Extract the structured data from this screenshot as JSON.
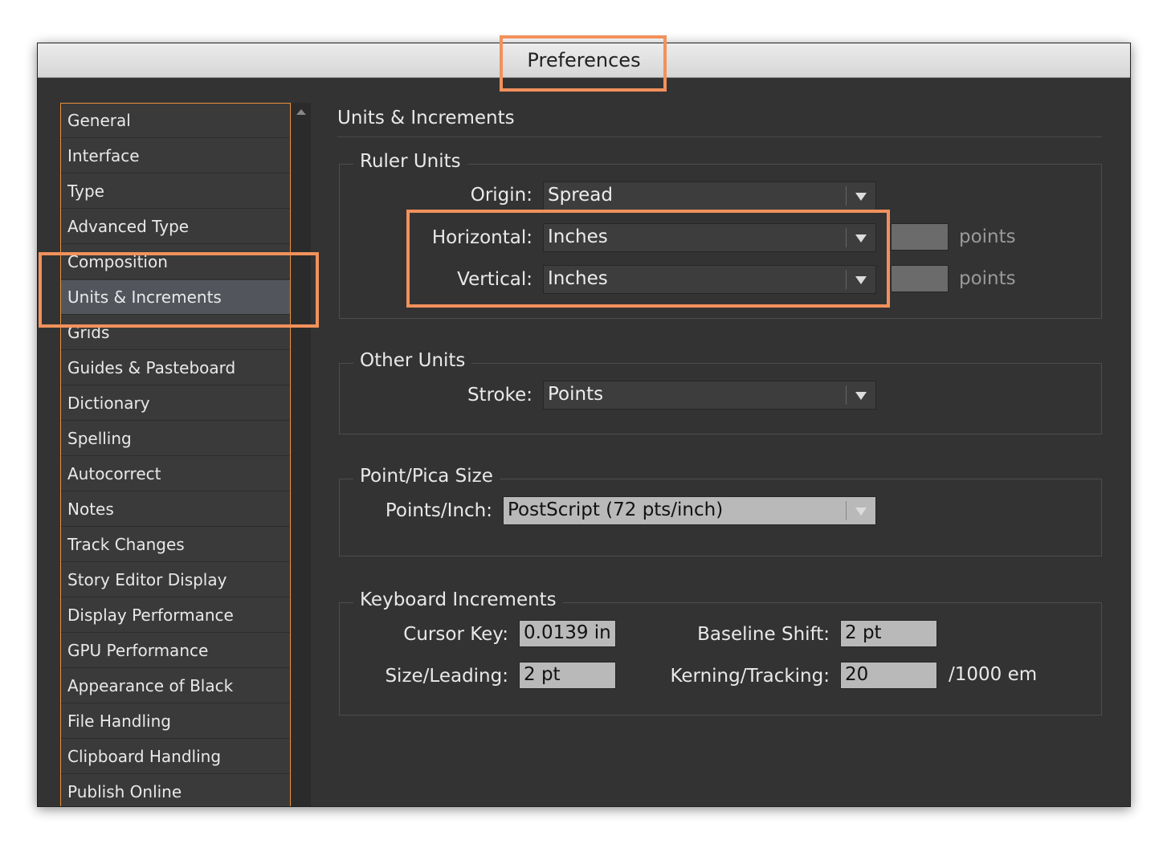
{
  "window": {
    "title": "Preferences"
  },
  "sidebar": {
    "items": [
      {
        "label": "General",
        "selected": false
      },
      {
        "label": "Interface",
        "selected": false
      },
      {
        "label": "Type",
        "selected": false
      },
      {
        "label": "Advanced Type",
        "selected": false
      },
      {
        "label": "Composition",
        "selected": false
      },
      {
        "label": "Units & Increments",
        "selected": true
      },
      {
        "label": "Grids",
        "selected": false
      },
      {
        "label": "Guides & Pasteboard",
        "selected": false
      },
      {
        "label": "Dictionary",
        "selected": false
      },
      {
        "label": "Spelling",
        "selected": false
      },
      {
        "label": "Autocorrect",
        "selected": false
      },
      {
        "label": "Notes",
        "selected": false
      },
      {
        "label": "Track Changes",
        "selected": false
      },
      {
        "label": "Story Editor Display",
        "selected": false
      },
      {
        "label": "Display Performance",
        "selected": false
      },
      {
        "label": "GPU Performance",
        "selected": false
      },
      {
        "label": "Appearance of Black",
        "selected": false
      },
      {
        "label": "File Handling",
        "selected": false
      },
      {
        "label": "Clipboard Handling",
        "selected": false
      },
      {
        "label": "Publish Online",
        "selected": false
      }
    ]
  },
  "content": {
    "title": "Units & Increments",
    "ruler_units": {
      "legend": "Ruler Units",
      "origin": {
        "label": "Origin:",
        "value": "Spread"
      },
      "horizontal": {
        "label": "Horizontal:",
        "value": "Inches",
        "points_value": "",
        "points_unit": "points"
      },
      "vertical": {
        "label": "Vertical:",
        "value": "Inches",
        "points_value": "",
        "points_unit": "points"
      }
    },
    "other_units": {
      "legend": "Other Units",
      "stroke": {
        "label": "Stroke:",
        "value": "Points"
      }
    },
    "point_pica": {
      "legend": "Point/Pica Size",
      "points_inch": {
        "label": "Points/Inch:",
        "value": "PostScript (72 pts/inch)"
      }
    },
    "keyboard": {
      "legend": "Keyboard Increments",
      "cursor_key": {
        "label": "Cursor Key:",
        "value": "0.0139 in"
      },
      "size_leading": {
        "label": "Size/Leading:",
        "value": "2 pt"
      },
      "baseline_shift": {
        "label": "Baseline Shift:",
        "value": "2 pt"
      },
      "kerning_tracking": {
        "label": "Kerning/Tracking:",
        "value": "20",
        "unit": "/1000 em"
      }
    }
  },
  "colors": {
    "highlight": "#f2915c",
    "window_bg": "#333333",
    "selected_item": "#52565c"
  }
}
